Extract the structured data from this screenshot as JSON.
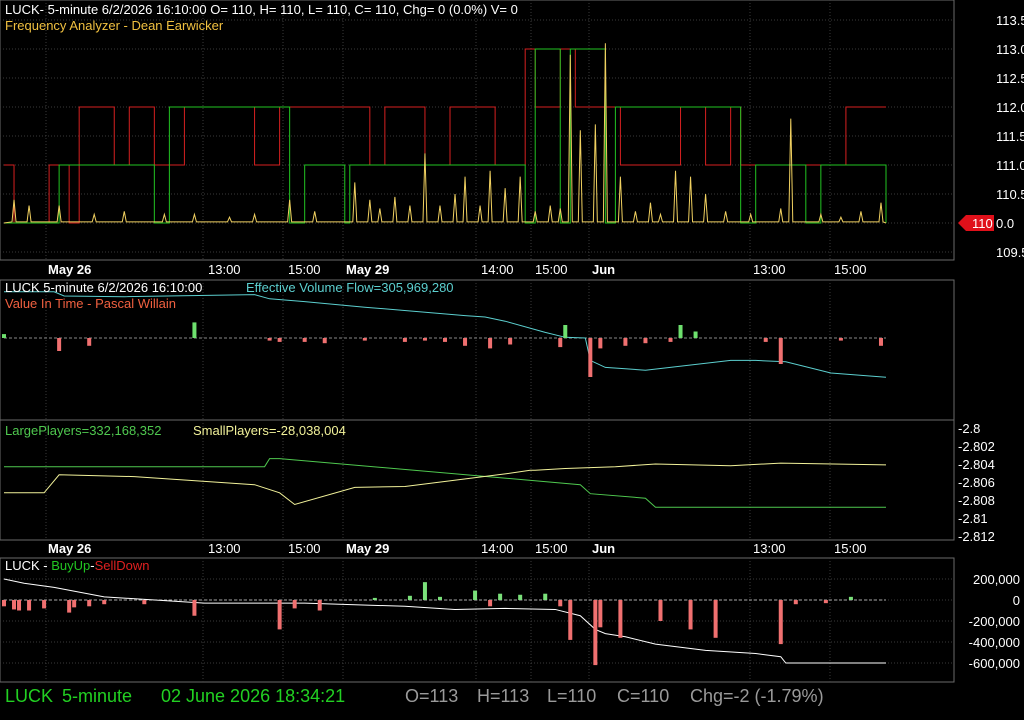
{
  "colors": {
    "background": "#000000",
    "grid": "#3a3a3a",
    "panel_border": "#6a6a6a",
    "freq_red": "#d62020",
    "freq_green": "#22c422",
    "freq_yellow": "#f0d060",
    "vit_line": "#5ccfcf",
    "vit_pos": "#6ee06e",
    "vit_neg": "#f07070",
    "large_players": "#4fc84f",
    "small_players": "#f2f29a",
    "buy_up": "#7ae07a",
    "sell_down": "#f07070",
    "white_line": "#ffffff",
    "status_green": "#22d022",
    "status_gray": "#9a9a9a",
    "marker": "#e0101a"
  },
  "panel1": {
    "header": "LUCK- 5-minute 6/2/2026 16:10:00 O= 110, H= 110, L= 110, C= 110, Chg= 0 (0.0%) V= 0",
    "indicator": "Frequency Analyzer - Dean Earwicker",
    "price_marker": "110",
    "price_marker_axis": "0.0"
  },
  "panel2": {
    "symbol": "LUCK 5-minute  6/2/2026 16:10:00",
    "evf": "Effective Volume Flow=305,969,280",
    "indicator": "Value In Time - Pascal Willain"
  },
  "panel3": {
    "large": "LargePlayers=332,168,352",
    "small": "SmallPlayers=-28,038,004"
  },
  "panel4": {
    "symbol": "LUCK - ",
    "buy": "BuyUp",
    "sep": "-",
    "sell": "SellDown"
  },
  "date_axis": [
    {
      "label": "May 26",
      "bold": true
    },
    {
      "label": "13:00",
      "bold": false
    },
    {
      "label": "15:00",
      "bold": false
    },
    {
      "label": "May 29",
      "bold": true
    },
    {
      "label": "14:00",
      "bold": false
    },
    {
      "label": "15:00",
      "bold": false
    },
    {
      "label": "Jun",
      "bold": true
    },
    {
      "label": "13:00",
      "bold": false
    },
    {
      "label": "15:00",
      "bold": false
    }
  ],
  "status": {
    "symbol": "LUCK",
    "interval": "5-minute",
    "datetime": "02 June 2026 18:34:21",
    "open": "O=113",
    "high": "H=113",
    "low": "L=110",
    "close": "C=110",
    "change": "Chg=-2 (-1.79%)"
  },
  "chart_data": [
    {
      "type": "line",
      "title": "Frequency Analyzer - Dean Earwicker",
      "ylim": [
        109.3,
        113.7
      ],
      "y_ticks": [
        "113.5",
        "113.0",
        "112.5",
        "112.0",
        "111.5",
        "111.0",
        "110.5",
        "110.0",
        "109.5"
      ],
      "x_range": [
        0,
        176
      ],
      "red_step": {
        "x": [
          0,
          2,
          9,
          13,
          15,
          22,
          25,
          30,
          36,
          50,
          55,
          73,
          76,
          84,
          89,
          98,
          104,
          106,
          111,
          114,
          121,
          123,
          135,
          140,
          145,
          147,
          168,
          176
        ],
        "y": [
          111,
          110,
          111,
          110,
          112,
          111,
          112,
          111,
          112,
          111,
          112,
          111,
          112,
          111,
          112,
          111,
          113,
          112,
          113,
          112,
          112,
          111,
          112,
          111,
          112,
          111,
          112,
          112
        ]
      },
      "green_step": {
        "x": [
          0,
          9,
          11,
          30,
          33,
          57,
          60,
          68,
          69,
          104,
          106,
          111,
          113,
          120,
          122,
          147,
          150,
          160,
          163,
          176
        ],
        "y": [
          110,
          110,
          111,
          110,
          112,
          110,
          111,
          110,
          111,
          110,
          113,
          110,
          113,
          110,
          112,
          110,
          111,
          110,
          111,
          110
        ]
      },
      "yellow_spikes": [
        {
          "x": 2,
          "y": 110.4
        },
        {
          "x": 5,
          "y": 110.3
        },
        {
          "x": 11,
          "y": 110.3
        },
        {
          "x": 18,
          "y": 110.15
        },
        {
          "x": 24,
          "y": 110.2
        },
        {
          "x": 32,
          "y": 110.15
        },
        {
          "x": 38,
          "y": 110.15
        },
        {
          "x": 45,
          "y": 110.1
        },
        {
          "x": 50,
          "y": 110.15
        },
        {
          "x": 57,
          "y": 110.4
        },
        {
          "x": 62,
          "y": 110.2
        },
        {
          "x": 70,
          "y": 110.7
        },
        {
          "x": 73,
          "y": 110.4
        },
        {
          "x": 75,
          "y": 110.25
        },
        {
          "x": 78,
          "y": 110.45
        },
        {
          "x": 81,
          "y": 110.3
        },
        {
          "x": 84,
          "y": 111.2
        },
        {
          "x": 87,
          "y": 110.3
        },
        {
          "x": 90,
          "y": 110.5
        },
        {
          "x": 92,
          "y": 110.8
        },
        {
          "x": 95,
          "y": 110.3
        },
        {
          "x": 97,
          "y": 110.9
        },
        {
          "x": 100,
          "y": 110.6
        },
        {
          "x": 103,
          "y": 110.8
        },
        {
          "x": 106,
          "y": 110.2
        },
        {
          "x": 109,
          "y": 110.3
        },
        {
          "x": 111,
          "y": 110.25
        },
        {
          "x": 113,
          "y": 112.9
        },
        {
          "x": 115,
          "y": 111.6
        },
        {
          "x": 118,
          "y": 111.7
        },
        {
          "x": 120,
          "y": 113.1
        },
        {
          "x": 123,
          "y": 110.8
        },
        {
          "x": 126,
          "y": 110.2
        },
        {
          "x": 129,
          "y": 110.35
        },
        {
          "x": 131,
          "y": 110.15
        },
        {
          "x": 134,
          "y": 110.9
        },
        {
          "x": 137,
          "y": 110.8
        },
        {
          "x": 140,
          "y": 110.5
        },
        {
          "x": 144,
          "y": 110.2
        },
        {
          "x": 149,
          "y": 110.15
        },
        {
          "x": 155,
          "y": 110.25
        },
        {
          "x": 157,
          "y": 111.8
        },
        {
          "x": 163,
          "y": 110.15
        },
        {
          "x": 167,
          "y": 110.1
        },
        {
          "x": 171,
          "y": 110.2
        },
        {
          "x": 175,
          "y": 110.35
        }
      ]
    },
    {
      "type": "bar",
      "title": "Value In Time - Pascal Willain",
      "series": [
        {
          "name": "Effective Volume Flow",
          "x": [
            0,
            10,
            12,
            24,
            50,
            53,
            60,
            72,
            92,
            96,
            100,
            108,
            112,
            116,
            117,
            120,
            124,
            128,
            145,
            150,
            156,
            165,
            176
          ],
          "values": [
            3.3,
            3.3,
            3.0,
            2.95,
            3.1,
            2.8,
            2.6,
            2.2,
            1.6,
            1.5,
            1.2,
            0.4,
            0.05,
            0.0,
            -1.6,
            -2.1,
            -2.2,
            -2.3,
            -1.6,
            -1.6,
            -1.7,
            -2.5,
            -2.8
          ]
        },
        {
          "name": "Value In Time",
          "x": [
            0,
            11,
            17,
            38,
            53,
            55,
            60,
            64,
            72,
            80,
            84,
            88,
            92,
            97,
            101,
            111,
            112,
            117,
            119,
            124,
            128,
            133,
            135,
            138,
            152,
            155,
            167,
            175
          ],
          "values": [
            0.3,
            -1.0,
            -0.6,
            1.2,
            -0.2,
            -0.3,
            -0.3,
            -0.4,
            -0.2,
            -0.3,
            -0.2,
            -0.3,
            -0.6,
            -0.8,
            -0.5,
            -0.7,
            1.0,
            -3.0,
            -0.8,
            -0.6,
            -0.4,
            -0.3,
            1.0,
            0.5,
            -0.3,
            -2.0,
            -0.2,
            -0.6
          ]
        }
      ]
    },
    {
      "type": "line",
      "y_ticks": [
        "-2.8",
        "-2.802",
        "-2.804",
        "-2.806",
        "-2.808",
        "-2.81",
        "-2.812"
      ],
      "ylim": [
        -2.8125,
        -2.7995
      ],
      "series": [
        {
          "name": "LargePlayers",
          "x": [
            0,
            52,
            53,
            55,
            115,
            117,
            128,
            130,
            176
          ],
          "values": [
            -2.8043,
            -2.8043,
            -2.8034,
            -2.8034,
            -2.8063,
            -2.8073,
            -2.8078,
            -2.8088,
            -2.8088
          ]
        },
        {
          "name": "SmallPlayers",
          "x": [
            0,
            8,
            11,
            26,
            50,
            55,
            58,
            70,
            80,
            100,
            105,
            106,
            112,
            122,
            130,
            145,
            155,
            176
          ],
          "values": [
            -2.8072,
            -2.8072,
            -2.8052,
            -2.8054,
            -2.8063,
            -2.8072,
            -2.8085,
            -2.8066,
            -2.8065,
            -2.8051,
            -2.8047,
            -2.8047,
            -2.8045,
            -2.8043,
            -2.804,
            -2.8042,
            -2.8039,
            -2.8041
          ]
        }
      ]
    },
    {
      "type": "bar",
      "title": "BuyUp-SellDown",
      "y_ticks": [
        "200,000",
        "0",
        "-200,000",
        "-400,000",
        "-600,000"
      ],
      "ylim": [
        -700000,
        260000
      ],
      "series": [
        {
          "name": "cumulative",
          "x": [
            0,
            4,
            10,
            20,
            40,
            60,
            80,
            90,
            100,
            110,
            115,
            118,
            120,
            124,
            130,
            140,
            150,
            155,
            156,
            176
          ],
          "values": [
            200000,
            160000,
            120000,
            30000,
            -30000,
            -30000,
            -60000,
            -90000,
            -80000,
            -90000,
            -150000,
            -280000,
            -320000,
            -350000,
            -420000,
            -480000,
            -510000,
            -540000,
            -600000,
            -600000
          ]
        },
        {
          "name": "BuyUp-SellDown",
          "x": [
            0,
            2,
            3,
            5,
            8,
            13,
            14,
            17,
            20,
            28,
            38,
            55,
            58,
            63,
            74,
            81,
            84,
            87,
            94,
            97,
            99,
            103,
            108,
            111,
            113,
            118,
            119,
            123,
            131,
            137,
            142,
            155,
            158,
            164,
            169
          ],
          "values": [
            -60000,
            -90000,
            -100000,
            -100000,
            -80000,
            -120000,
            -70000,
            -60000,
            -40000,
            -40000,
            -150000,
            -280000,
            -80000,
            -100000,
            20000,
            40000,
            170000,
            30000,
            90000,
            -60000,
            60000,
            50000,
            60000,
            -60000,
            -380000,
            -620000,
            -260000,
            -360000,
            -200000,
            -280000,
            -360000,
            -420000,
            -40000,
            -30000,
            30000
          ]
        }
      ]
    }
  ]
}
